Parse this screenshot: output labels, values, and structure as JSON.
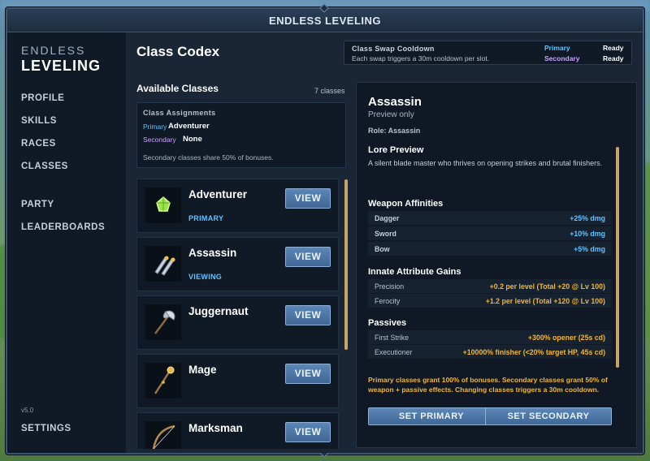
{
  "window": {
    "title": "ENDLESS LEVELING"
  },
  "sidebar": {
    "brand_top": "ENDLESS",
    "brand_bottom": "LEVELING",
    "items": [
      {
        "label": "PROFILE"
      },
      {
        "label": "SKILLS"
      },
      {
        "label": "RACES"
      },
      {
        "label": "CLASSES"
      },
      {
        "label": "PARTY"
      },
      {
        "label": "LEADERBOARDS"
      }
    ],
    "version": "v5.0",
    "settings": "SETTINGS"
  },
  "main": {
    "title": "Class Codex",
    "cooldown": {
      "title": "Class Swap Cooldown",
      "subtitle": "Each swap triggers a 30m cooldown per slot.",
      "primary_label": "Primary",
      "primary_status": "Ready",
      "secondary_label": "Secondary",
      "secondary_status": "Ready"
    },
    "available": {
      "title": "Available Classes",
      "count": "7 classes"
    },
    "assignments": {
      "title": "Class Assignments",
      "primary_label": "Primary",
      "primary_value": "Adventurer",
      "secondary_label": "Secondary",
      "secondary_value": "None",
      "note": "Secondary classes share 50% of bonuses."
    },
    "classes": [
      {
        "name": "Adventurer",
        "status": "PRIMARY",
        "icon": "green-gem-icon",
        "button": "VIEW"
      },
      {
        "name": "Assassin",
        "status": "VIEWING",
        "icon": "twin-daggers-icon",
        "button": "VIEW"
      },
      {
        "name": "Juggernaut",
        "status": "",
        "icon": "battle-axe-icon",
        "button": "VIEW"
      },
      {
        "name": "Mage",
        "status": "",
        "icon": "staff-icon",
        "button": "VIEW"
      },
      {
        "name": "Marksman",
        "status": "",
        "icon": "bow-icon",
        "button": "VIEW"
      }
    ]
  },
  "detail": {
    "name": "Assassin",
    "preview": "Preview only",
    "role": "Role: Assassin",
    "lore_title": "Lore Preview",
    "lore": "A silent blade master who thrives on opening strikes and brutal finishers.",
    "weapon_title": "Weapon Affinities",
    "weapons": [
      {
        "label": "Dagger",
        "value": "+25% dmg"
      },
      {
        "label": "Sword",
        "value": "+10% dmg"
      },
      {
        "label": "Bow",
        "value": "+5% dmg"
      }
    ],
    "attr_title": "Innate Attribute Gains",
    "attributes": [
      {
        "label": "Precision",
        "value": "+0.2 per level (Total +20 @ Lv 100)"
      },
      {
        "label": "Ferocity",
        "value": "+1.2 per level (Total +120 @ Lv 100)"
      }
    ],
    "passives_title": "Passives",
    "passives": [
      {
        "label": "First Strike",
        "value": "+300% opener (25s cd)"
      },
      {
        "label": "Executioner",
        "value": "+10000% finisher (<20% target HP, 45s cd)"
      }
    ],
    "note": "Primary classes grant 100% of bonuses. Secondary classes grant 50% of weapon + passive effects. Changing classes triggers a 30m cooldown.",
    "set_primary": "SET PRIMARY",
    "set_secondary": "SET SECONDARY"
  },
  "colors": {
    "primary": "#5ec3ff",
    "secondary": "#c8a2ff",
    "weapon_value": "#5ec3ff",
    "attr_value": "#f2b630",
    "accent_scroll": "#c7a36a"
  }
}
